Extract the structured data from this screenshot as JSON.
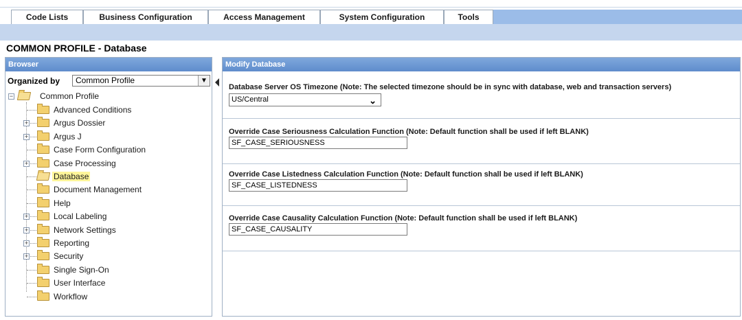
{
  "menu": {
    "tabs": [
      {
        "label": "Code Lists"
      },
      {
        "label": "Business Configuration"
      },
      {
        "label": "Access Management"
      },
      {
        "label": "System Configuration"
      },
      {
        "label": "Tools"
      }
    ],
    "accent_color": "#9bbce8"
  },
  "page_title": "COMMON PROFILE - Database",
  "browser": {
    "header": "Browser",
    "organized_by_label": "Organized by",
    "organized_by_value": "Common Profile",
    "tree": {
      "root": "Common Profile",
      "items": [
        {
          "label": "Advanced Conditions",
          "expandable": false,
          "selected": false
        },
        {
          "label": "Argus Dossier",
          "expandable": true,
          "selected": false
        },
        {
          "label": "Argus J",
          "expandable": true,
          "selected": false
        },
        {
          "label": "Case Form Configuration",
          "expandable": false,
          "selected": false
        },
        {
          "label": "Case Processing",
          "expandable": true,
          "selected": false
        },
        {
          "label": "Database",
          "expandable": false,
          "selected": true
        },
        {
          "label": "Document Management",
          "expandable": false,
          "selected": false
        },
        {
          "label": "Help",
          "expandable": false,
          "selected": false
        },
        {
          "label": "Local Labeling",
          "expandable": true,
          "selected": false
        },
        {
          "label": "Network Settings",
          "expandable": true,
          "selected": false
        },
        {
          "label": "Reporting",
          "expandable": true,
          "selected": false
        },
        {
          "label": "Security",
          "expandable": true,
          "selected": false
        },
        {
          "label": "Single Sign-On",
          "expandable": false,
          "selected": false
        },
        {
          "label": "User Interface",
          "expandable": false,
          "selected": false
        },
        {
          "label": "Workflow",
          "expandable": false,
          "selected": false
        }
      ]
    }
  },
  "modify": {
    "header": "Modify Database",
    "timezone": {
      "label": "Database Server OS Timezone (Note: The selected timezone should be in sync with database, web and transaction servers)",
      "value": "US/Central"
    },
    "seriousness": {
      "label": "Override Case Seriousness Calculation Function (Note: Default function shall be used if left BLANK)",
      "value": "SF_CASE_SERIOUSNESS"
    },
    "listedness": {
      "label": "Override Case Listedness Calculation Function (Note: Default function shall be used if left BLANK)",
      "value": "SF_CASE_LISTEDNESS"
    },
    "causality": {
      "label": "Override Case Causality Calculation Function (Note: Default function shall be used if left BLANK)",
      "value": "SF_CASE_CAUSALITY"
    }
  }
}
